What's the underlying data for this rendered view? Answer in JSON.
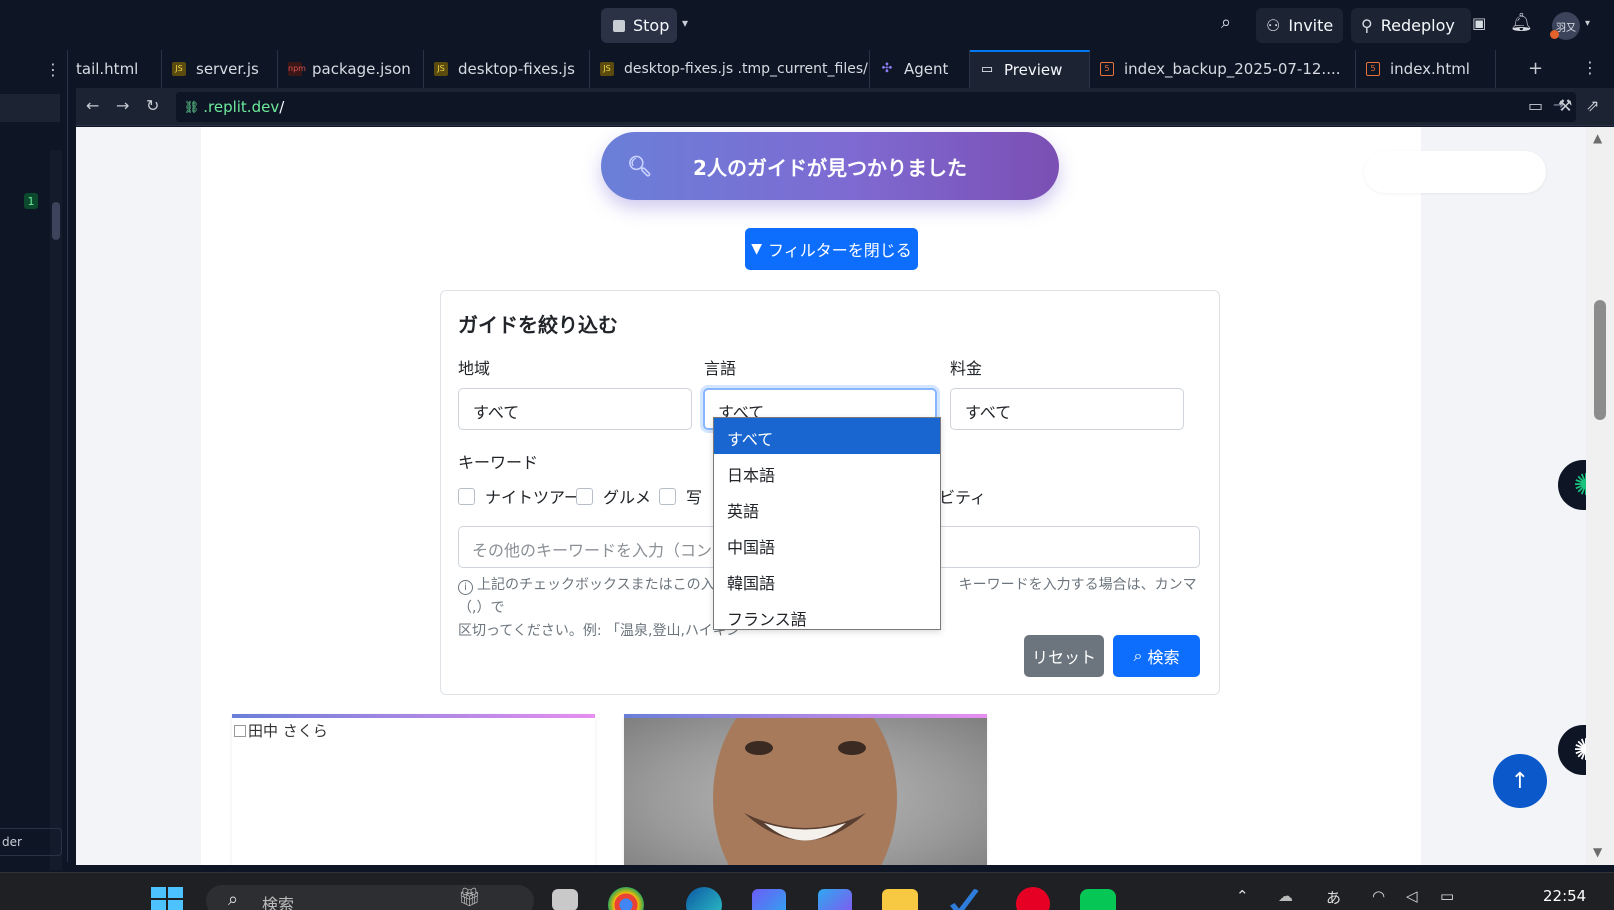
{
  "topbar": {
    "stop_label": "Stop",
    "invite_label": "Invite",
    "redeploy_label": "Redeploy",
    "avatar_text": "羽又"
  },
  "sidebar": {
    "badge": "1",
    "bottom_text": "der"
  },
  "tabs": [
    {
      "label": "tail.html",
      "type": "html"
    },
    {
      "label": "server.js",
      "type": "js"
    },
    {
      "label": "package.json",
      "type": "json"
    },
    {
      "label": "desktop-fixes.js",
      "type": "js"
    },
    {
      "label": "desktop-fixes.js .tmp_current_files/",
      "type": "js"
    },
    {
      "label": "Agent",
      "type": "agent"
    },
    {
      "label": "Preview",
      "type": "preview"
    },
    {
      "label": "index_backup_2025-07-12....",
      "type": "html"
    },
    {
      "label": "index.html",
      "type": "html"
    }
  ],
  "addressbar": {
    "host": ".replit.dev",
    "path": "/"
  },
  "page": {
    "banner_text": "2人のガイドが見つかりました",
    "filter_toggle_label": "フィルターを閉じる",
    "filter": {
      "title": "ガイドを絞り込む",
      "region_label": "地域",
      "region_value": "すべて",
      "language_label": "言語",
      "language_value": "すべて",
      "fee_label": "料金",
      "fee_value": "すべて",
      "keyword_label": "キーワード",
      "checkboxes": [
        "ナイトツアー",
        "グルメ",
        "写",
        "ィビティ"
      ],
      "keyword_placeholder": "その他のキーワードを入力（コンマ区",
      "help_line1_a": "上記のチェックボックスまたはこの入力欄",
      "help_line1_b": "キーワードを入力する場合は、カンマ（,）で",
      "help_line2": "区切ってください。例: 「温泉,登山,ハイキン",
      "reset_label": "リセット",
      "search_label": "検索"
    },
    "language_dropdown": [
      "すべて",
      "日本語",
      "英語",
      "中国語",
      "韓国語",
      "フランス語"
    ],
    "guide_cards": [
      {
        "alt_text": "田中 さくら"
      }
    ]
  },
  "taskbar": {
    "search_placeholder": "検索",
    "ime": "あ",
    "clock": "22:54"
  }
}
